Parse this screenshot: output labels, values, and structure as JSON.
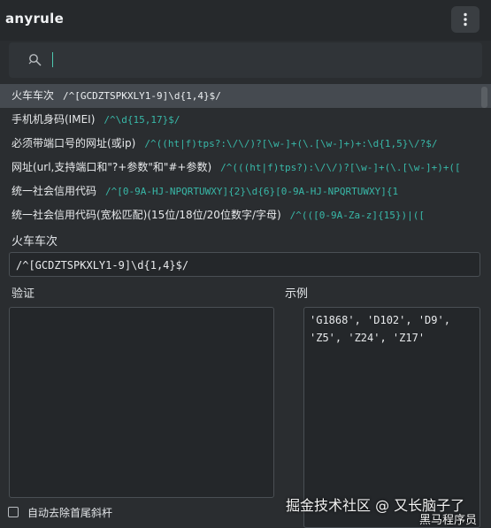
{
  "app": {
    "title": "anyrule",
    "menu_icon": "more-vertical-icon"
  },
  "search": {
    "value": "",
    "placeholder": "",
    "icon": "search-icon"
  },
  "rules": [
    {
      "name": "火车车次",
      "regex": "/^[GCDZTSPKXLY1-9]\\d{1,4}$/",
      "selected": true
    },
    {
      "name": "手机机身码(IMEI)",
      "regex": "/^\\d{15,17}$/",
      "selected": false
    },
    {
      "name": "必须带端口号的网址(或ip)",
      "regex": "/^((ht|f)tps?:\\/\\/)?[\\w-]+(\\.[\\w-]+)+:\\d{1,5}\\/?$/",
      "selected": false
    },
    {
      "name": "网址(url,支持端口和\"?+参数\"和\"#+参数)",
      "regex": "/^(((ht|f)tps?):\\/\\/)?[\\w-]+(\\.[\\w-]+)+([",
      "selected": false
    },
    {
      "name": "统一社会信用代码",
      "regex": "/^[0-9A-HJ-NPQRTUWXY]{2}\\d{6}[0-9A-HJ-NPQRTUWXY]{1",
      "selected": false
    },
    {
      "name": "统一社会信用代码(宽松匹配)(15位/18位/20位数字/字母)",
      "regex": "/^(([0-9A-Za-z]{15})|([",
      "selected": false
    }
  ],
  "detail": {
    "title": "火车车次",
    "regex": "/^[GCDZTSPKXLY1-9]\\d{1,4}$/",
    "verify_label": "验证",
    "example_label": "示例",
    "verify_value": "",
    "example_line1": "'G1868', 'D102', 'D9',",
    "example_line2": "'Z5', 'Z24', 'Z17'"
  },
  "options": {
    "strip_slashes_label": "自动去除首尾斜杆",
    "strip_slashes_checked": false
  },
  "watermark": {
    "line1": "掘金技术社区 @ 又长脑子了",
    "line2": "黑马程序员"
  },
  "colors": {
    "accent": "#38b8a8",
    "background": "#2a2d30",
    "selected_row": "#454a50"
  }
}
